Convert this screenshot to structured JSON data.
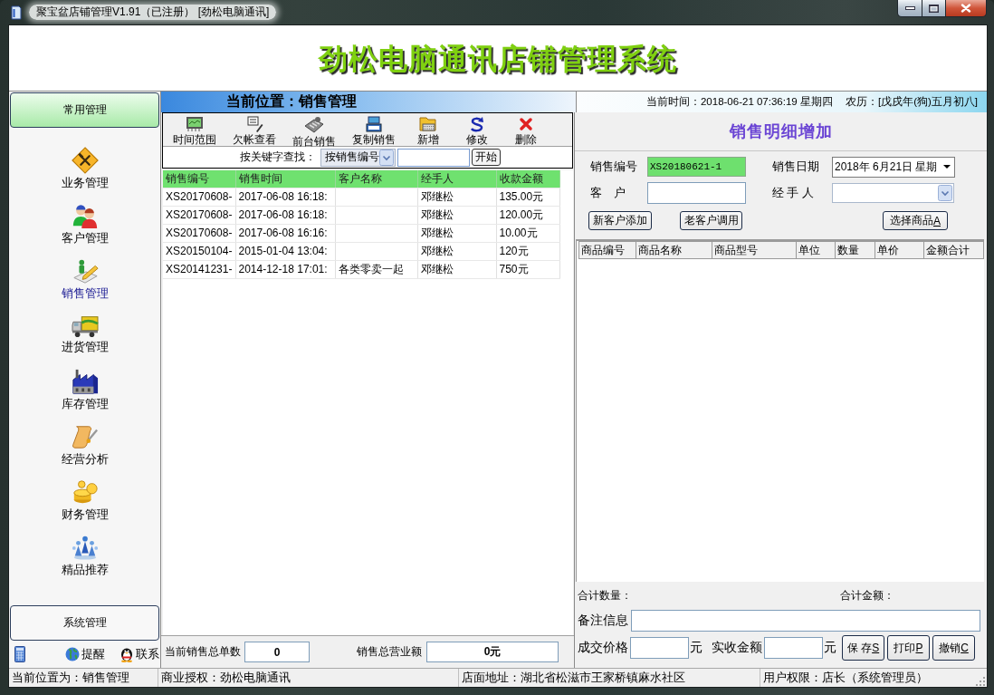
{
  "window": {
    "title": "聚宝盆店铺管理V1.91（已注册） [劲松电脑通讯]"
  },
  "banner": {
    "title": "劲松电脑通讯店铺管理系统"
  },
  "sidebar": {
    "sections": [
      {
        "label": "常用管理",
        "expanded": true,
        "items": [
          {
            "label": "业务管理",
            "selected": false
          },
          {
            "label": "客户管理",
            "selected": false
          },
          {
            "label": "销售管理",
            "selected": true
          },
          {
            "label": "进货管理",
            "selected": false
          },
          {
            "label": "库存管理",
            "selected": false
          },
          {
            "label": "经营分析",
            "selected": false
          },
          {
            "label": "财务管理",
            "selected": false
          },
          {
            "label": "精品推荐",
            "selected": false
          }
        ]
      },
      {
        "label": "系统管理",
        "expanded": false
      }
    ],
    "footer_links": [
      "提醒",
      "联系"
    ]
  },
  "location_bar": {
    "location": "当前位置：销售管理",
    "current_time": "当前时间：2018-06-21 07:36:19 星期四",
    "lunar_date": "农历：[戊戌年(狗)五月初八]"
  },
  "sales_list": {
    "toolbar": [
      "时间范围",
      "欠帐查看",
      "前台销售",
      "复制销售",
      "新增",
      "修改",
      "删除"
    ],
    "search": {
      "label": "按关键字查找：",
      "mode": "按销售编号",
      "button": "开始"
    },
    "table": {
      "columns": [
        "销售编号",
        "销售时间",
        "客户名称",
        "经手人",
        "收款金额"
      ],
      "rows": [
        [
          "XS20170608-",
          "2017-06-08 16:18:",
          null,
          "邓继松",
          "135.00元"
        ],
        [
          "XS20170608-",
          "2017-06-08 16:18:",
          null,
          "邓继松",
          "120.00元"
        ],
        [
          "XS20170608-",
          "2017-06-08 16:16:",
          null,
          "邓继松",
          "10.00元"
        ],
        [
          "XS20150104-",
          "2015-01-04 13:04:",
          null,
          "邓继松",
          "120元"
        ],
        [
          "XS20141231-",
          "2014-12-18 17:01:",
          "各类零卖一起",
          "邓继松",
          "750元"
        ]
      ]
    },
    "totals": {
      "count_label": "当前销售总单数",
      "count": "0",
      "amount_label": "销售总营业额",
      "amount": "0元"
    }
  },
  "sale_detail": {
    "title": "销售明细增加",
    "sale_number": {
      "label": "销售编号",
      "value": "XS20180621-1"
    },
    "sale_date": {
      "label": "销售日期",
      "value": "2018年 6月21日 星期"
    },
    "customer": {
      "label": "客　户"
    },
    "handler": {
      "label": "经 手 人"
    },
    "buttons": [
      {
        "label": "新客户添加"
      },
      {
        "label": "老客户调用"
      },
      {
        "label": "选择商品",
        "accesskey": "A"
      }
    ],
    "table": {
      "columns": [
        "商品编号",
        "商品名称",
        "商品型号",
        "单位",
        "数量",
        "单价",
        "金额合计"
      ]
    },
    "total_quantity_label": "合计数量：",
    "total_amount_label": "合计金额：",
    "remark_label": "备注信息",
    "deal_price": {
      "label": "成交价格",
      "unit": "元"
    },
    "received_amount": {
      "label": "实收金额",
      "unit": "元"
    },
    "actions": [
      {
        "label": "保 存",
        "accesskey": "S"
      },
      {
        "label": "打印",
        "accesskey": "P"
      },
      {
        "label": "撤销",
        "accesskey": "C"
      }
    ]
  },
  "status_bar": [
    "当前位置为：销售管理",
    "商业授权：劲松电脑通讯",
    "店面地址：湖北省松滋市王家桥镇麻水社区",
    "用户权限：店长（系统管理员）"
  ]
}
